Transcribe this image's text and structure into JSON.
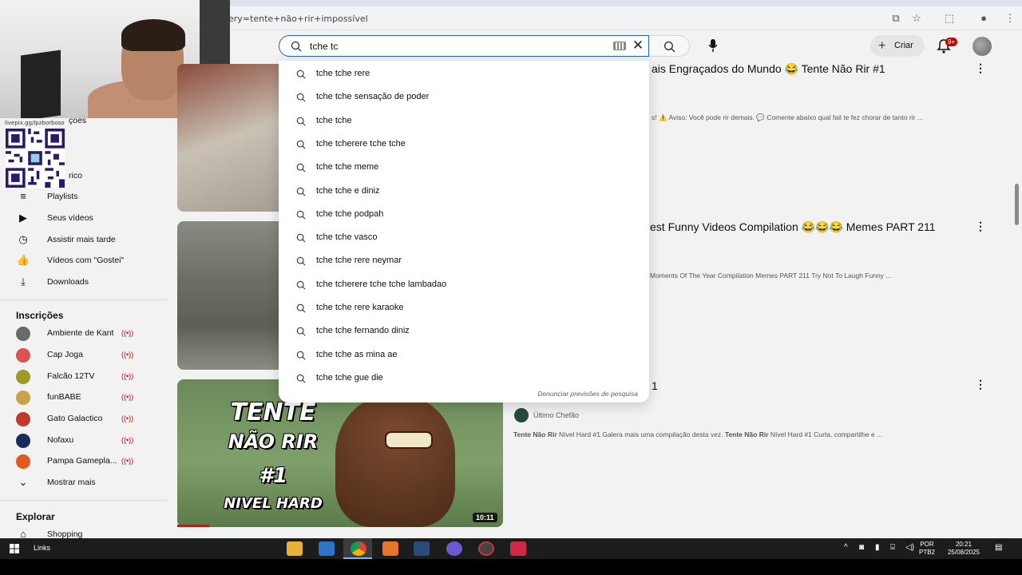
{
  "browser": {
    "url": "ery=tente+não+rir+impossível"
  },
  "header": {
    "search_value": "tche tc",
    "create_label": "Criar",
    "notifications_badge": "9+"
  },
  "webcam": {
    "url_text": "livepix.gg/lpzborboso"
  },
  "sidebar": {
    "partial_items": [
      "ções",
      "rico"
    ],
    "items": [
      {
        "label": "Playlists",
        "icon": "playlist-icon"
      },
      {
        "label": "Seus vídeos",
        "icon": "video-icon"
      },
      {
        "label": "Assistir mais tarde",
        "icon": "clock-icon"
      },
      {
        "label": "Vídeos com \"Gostei\"",
        "icon": "thumbs-up-icon"
      },
      {
        "label": "Downloads",
        "icon": "download-icon"
      }
    ],
    "subscriptions_title": "Inscrições",
    "subscriptions": [
      {
        "label": "Ambiente de Kant",
        "color": "#6a6a6a"
      },
      {
        "label": "Cap Joga",
        "color": "#d9534f"
      },
      {
        "label": "Falcão 12TV",
        "color": "#9a9a2a"
      },
      {
        "label": "funBABE",
        "color": "#c9a24a"
      },
      {
        "label": "Gato Galactico",
        "color": "#c0392b"
      },
      {
        "label": "Nofaxu",
        "color": "#1a2a5a"
      },
      {
        "label": "Pampa Gamepla...",
        "color": "#e05a20"
      }
    ],
    "show_more": "Mostrar mais",
    "explore_title": "Explorar",
    "shopping": "Shopping"
  },
  "videos": [
    {
      "title": "ais Engraçados do Mundo 😂 Tente Não Rir #1",
      "desc": "s! ⚠️ Aviso: Você pode rir demais. 💬 Comente abaixo qual fail te fez chorar de tanto rir ..."
    },
    {
      "title": "est Funny Videos Compilation 😂😂😂 Memes PART 211",
      "desc": "Moments Of The Year Compilation Memes PART 211 Try Not To Laugh Funny ..."
    },
    {
      "title_fragment": "1",
      "channel": "Último Chefão",
      "desc_bold_1": "Tente Não Rir",
      "desc_1": " Nível Hard #1 Galera mais uma compilação desta vez. ",
      "desc_bold_2": "Tente Não Rir",
      "desc_2": " Nível Hard #1 Curta, compartilhe e ...",
      "thumb_lines": [
        "TENTE",
        "NÃO RIR",
        "#1",
        "NIVEL HARD"
      ],
      "duration": "10:11"
    }
  ],
  "suggestions": {
    "typed_prefix": "tche ",
    "items": [
      "tche rere",
      "tche sensação de poder",
      "tche",
      "tcherere tche tche",
      "tche meme",
      "tche e diniz",
      "tche podpah",
      "tche vasco",
      "tche rere neymar",
      "tcherere tche tche lambadao",
      "tche rere karaoke",
      "tche fernando diniz",
      "tche as mina ae",
      "tche gue die"
    ],
    "report_label": "Denunciar previsões de pesquisa"
  },
  "taskbar": {
    "links_label": "Links",
    "lang_line1": "POR",
    "lang_line2": "PTB2",
    "time": "20:21",
    "date": "25/08/2025"
  },
  "colors": {
    "accent_blue": "#1c62b9",
    "youtube_red": "#ff0000"
  }
}
